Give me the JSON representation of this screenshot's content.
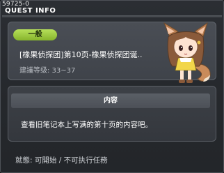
{
  "window": {
    "quest_id": "59725-0",
    "title": "QUEST INFO"
  },
  "quest": {
    "category_badge": "一般",
    "name": "[橡果侦探团]第10页-橡果侦探团诞..",
    "level_text": "建議等级: 33~37",
    "npc": "fox-eared-girl-npc"
  },
  "detail": {
    "header": "内容",
    "text": "查看旧笔记本上写满的第十页的内容吧。"
  },
  "status": {
    "text": "就態: 可開始 / 不可执行任務"
  },
  "colors": {
    "badge_green": "#9fcb44",
    "background": "#2b2e33"
  }
}
